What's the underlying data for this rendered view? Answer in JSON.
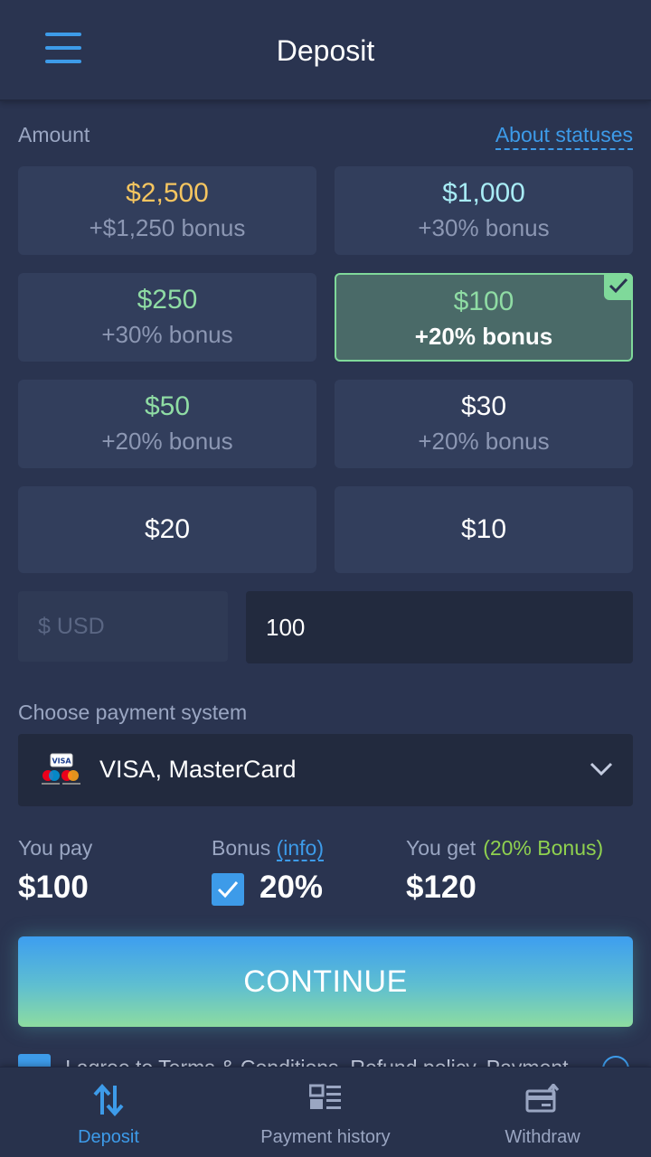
{
  "header": {
    "title": "Deposit"
  },
  "amount": {
    "label": "Amount",
    "about_link": "About statuses",
    "tiles": [
      {
        "amount": "$2,500",
        "bonus": "+$1,250 bonus",
        "amount_color": "#f5c560",
        "selected": false
      },
      {
        "amount": "$1,000",
        "bonus": "+30% bonus",
        "amount_color": "#a8ecf5",
        "selected": false
      },
      {
        "amount": "$250",
        "bonus": "+30% bonus",
        "amount_color": "#8fdca4",
        "selected": false
      },
      {
        "amount": "$100",
        "bonus": "+20% bonus",
        "amount_color": "#8fdca4",
        "selected": true
      },
      {
        "amount": "$50",
        "bonus": "+20% bonus",
        "amount_color": "#8fdca4",
        "selected": false
      },
      {
        "amount": "$30",
        "bonus": "+20% bonus",
        "amount_color": "#ffffff",
        "selected": false
      },
      {
        "amount": "$20",
        "bonus": "",
        "amount_color": "#ffffff",
        "selected": false
      },
      {
        "amount": "$10",
        "bonus": "",
        "amount_color": "#ffffff",
        "selected": false
      }
    ],
    "currency_placeholder": "$ USD",
    "input_value": "100"
  },
  "payment": {
    "label": "Choose payment system",
    "selected": "VISA, MasterCard",
    "card_logo_text": "VISA"
  },
  "summary": {
    "you_pay_label": "You pay",
    "you_pay_value": "$100",
    "bonus_label": "Bonus",
    "bonus_info": "(info)",
    "bonus_value": "20%",
    "bonus_checked": true,
    "you_get_label": "You get",
    "you_get_note": "(20% Bonus)",
    "you_get_value": "$120"
  },
  "continue_label": "CONTINUE",
  "terms_text": "I agree to Terms & Conditions, Refund policy, Payment",
  "bottom_nav": [
    {
      "label": "Deposit",
      "icon": "arrows-updown-icon",
      "active": true
    },
    {
      "label": "Payment history",
      "icon": "list-icon",
      "active": false
    },
    {
      "label": "Withdraw",
      "icon": "wallet-withdraw-icon",
      "active": false
    }
  ],
  "colors": {
    "accent": "#3d9be9",
    "selected_border": "#7fd99a",
    "bonus_green": "#8fd14f"
  }
}
